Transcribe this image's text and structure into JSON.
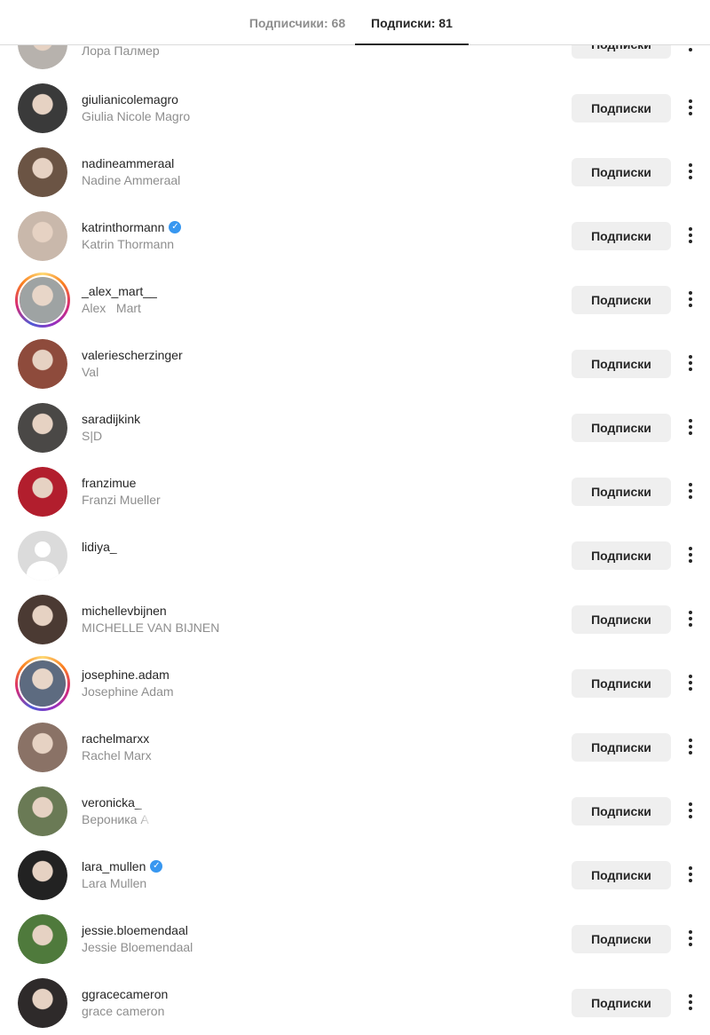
{
  "tabs": {
    "followers": "Подписчики: 68",
    "following": "Подписки: 81"
  },
  "button_label": "Подписки",
  "users": [
    {
      "username": "",
      "fullname": "Лора Палмер",
      "verified": false,
      "story": false,
      "color": "#b7b2ad"
    },
    {
      "username": "giulianicolemagro",
      "fullname": "Giulia Nicole Magro",
      "verified": false,
      "story": false,
      "color": "#3a3a3a"
    },
    {
      "username": "nadineammeraal",
      "fullname": "Nadine Ammeraal",
      "verified": false,
      "story": false,
      "color": "#6b5444"
    },
    {
      "username": "katrinthormann",
      "fullname": "Katrin Thormann",
      "verified": true,
      "story": false,
      "color": "#c9b8ab"
    },
    {
      "username": "_alex_mart__",
      "fullname": "Alex   Mart",
      "verified": false,
      "story": true,
      "color": "#9ea3a3"
    },
    {
      "username": "valeriescherzinger",
      "fullname": "Val",
      "verified": false,
      "story": false,
      "color": "#8e4b3c"
    },
    {
      "username": "saradijkink",
      "fullname": "S|D",
      "verified": false,
      "story": false,
      "color": "#4a4846"
    },
    {
      "username": "franzimue",
      "fullname": "Franzi Mueller",
      "verified": false,
      "story": false,
      "color": "#b21e2d"
    },
    {
      "username": "lidiya_",
      "fullname": "",
      "verified": false,
      "story": false,
      "placeholder": true,
      "color": "#dbdbdb"
    },
    {
      "username": "michellevbijnen",
      "fullname": "MICHELLE VAN BIJNEN",
      "verified": false,
      "story": false,
      "color": "#4b3a33"
    },
    {
      "username": "josephine.adam",
      "fullname": "Josephine Adam",
      "verified": false,
      "story": true,
      "color": "#5d6b80"
    },
    {
      "username": "rachelmarxx",
      "fullname": "Rachel Marx",
      "verified": false,
      "story": false,
      "color": "#8a7266"
    },
    {
      "username": "veronicka_",
      "fullname": "Вероника А",
      "verified": false,
      "story": false,
      "color": "#6a7a55"
    },
    {
      "username": "lara_mullen",
      "fullname": "Lara Mullen",
      "verified": true,
      "story": false,
      "color": "#222222"
    },
    {
      "username": "jessie.bloemendaal",
      "fullname": "Jessie Bloemendaal",
      "verified": false,
      "story": false,
      "color": "#4f7a3c"
    },
    {
      "username": "ggracecameron",
      "fullname": "grace cameron",
      "verified": false,
      "story": false,
      "color": "#2e2a2a"
    }
  ],
  "colors": {
    "text": "#262626",
    "secondary": "#8e8e8e",
    "button_bg": "#efefef",
    "verified": "#3897f0"
  },
  "icons": {
    "verified": "verified-badge-icon",
    "more": "more-vertical-icon"
  }
}
